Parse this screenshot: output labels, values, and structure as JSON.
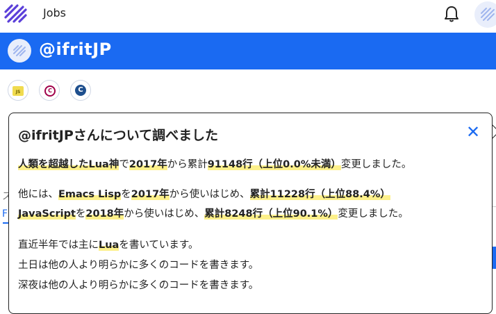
{
  "nav": {
    "jobs_label": "Jobs"
  },
  "user": {
    "name": "@ifritJP"
  },
  "languages": [
    {
      "icon": "javascript-icon",
      "glyph": "JS"
    },
    {
      "icon": "cpp-icon",
      "glyph": "C"
    },
    {
      "icon": "c-icon",
      "glyph": "C"
    }
  ],
  "popover": {
    "title": "@ifritJPさんについて調べました",
    "close_glyph": "✕",
    "p1": {
      "a": "人類を超越したLua神",
      "b": "で",
      "c": "2017年",
      "d": "から累計",
      "e": "91148行（上位0.0%未満）",
      "f": "変更しました。"
    },
    "p2": {
      "a": "他には、",
      "b": "Emacs Lisp",
      "c": "を",
      "d": "2017年",
      "e": "から使いはじめ、",
      "f": "累計11228行（上位88.4%）"
    },
    "p3": {
      "a": "JavaScript",
      "b": "を",
      "c": "2018年",
      "d": "から使いはじめ、",
      "e": "累計8248行（上位90.1%）",
      "f": "変更しました。"
    },
    "p4": {
      "a": "直近半年では主に",
      "b": "Lua",
      "c": "を書いています。"
    },
    "p5": "土日は他の人より明らかに多くのコードを書きます。",
    "p6": "深夜は他の人より明らかに多くのコードを書きます。"
  },
  "background": {
    "frag1": "ス",
    "frag2": "F"
  },
  "colors": {
    "brand_blue": "#1a6af2",
    "highlight": "#fdf08a"
  }
}
